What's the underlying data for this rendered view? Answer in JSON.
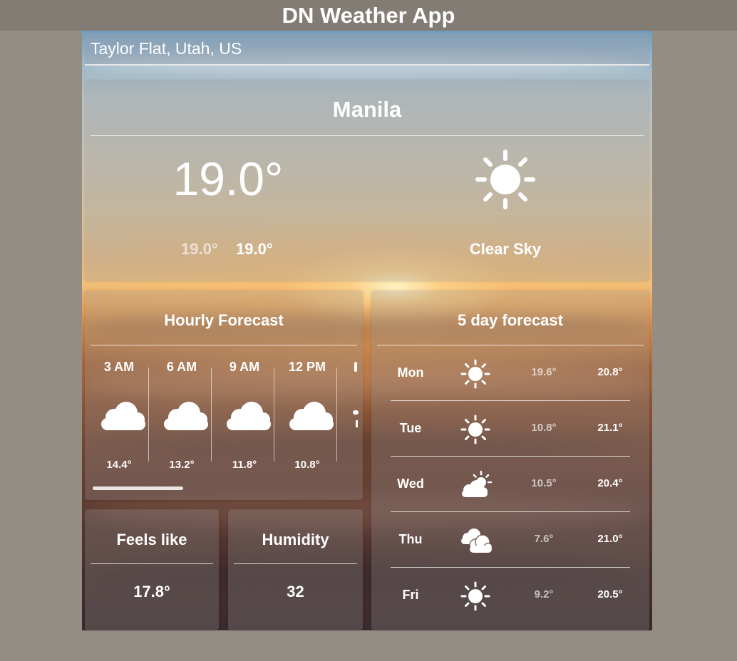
{
  "app": {
    "title": "DN Weather App"
  },
  "search": {
    "value": "Taylor Flat, Utah, US"
  },
  "current": {
    "city": "Manila",
    "temp": "19.0°",
    "temp_min": "19.0°",
    "temp_max": "19.0°",
    "condition": "Clear Sky",
    "icon": "sun-icon"
  },
  "hourly": {
    "title": "Hourly Forecast",
    "items": [
      {
        "time": "3 AM",
        "temp": "14.4°",
        "icon": "cloud-icon"
      },
      {
        "time": "6 AM",
        "temp": "13.2°",
        "icon": "cloud-icon"
      },
      {
        "time": "9 AM",
        "temp": "11.8°",
        "icon": "cloud-icon"
      },
      {
        "time": "12 PM",
        "temp": "10.8°",
        "icon": "cloud-icon"
      }
    ]
  },
  "daily": {
    "title": "5 day forecast",
    "items": [
      {
        "day": "Mon",
        "low": "19.6°",
        "high": "20.8°",
        "icon": "sun-icon"
      },
      {
        "day": "Tue",
        "low": "10.8°",
        "high": "21.1°",
        "icon": "sun-icon"
      },
      {
        "day": "Wed",
        "low": "10.5°",
        "high": "20.4°",
        "icon": "partly-cloudy-icon"
      },
      {
        "day": "Thu",
        "low": "7.6°",
        "high": "21.0°",
        "icon": "clouds-icon"
      },
      {
        "day": "Fri",
        "low": "9.2°",
        "high": "20.5°",
        "icon": "sun-icon"
      }
    ]
  },
  "feels_like": {
    "label": "Feels like",
    "value": "17.8°"
  },
  "humidity": {
    "label": "Humidity",
    "value": "32"
  },
  "colors": {
    "page_bg": "#938d83",
    "header_bg": "#827c74",
    "text": "#ffffff"
  }
}
